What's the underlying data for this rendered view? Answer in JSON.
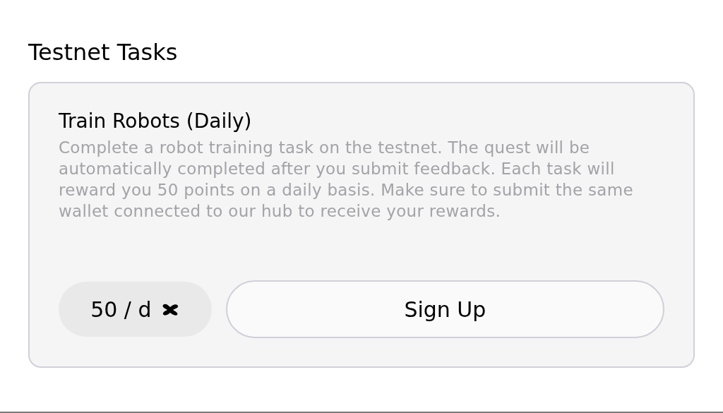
{
  "section_title": "Testnet Tasks",
  "task": {
    "title": "Train Robots (Daily)",
    "description": "Complete a robot training task on the testnet. The quest will be automatically completed after you submit feedback. Each task will reward you 50 points on a daily basis. Make sure to submit the same wallet connected to our hub to receive your rewards.",
    "reward": "50 / d",
    "button": "Sign Up"
  }
}
